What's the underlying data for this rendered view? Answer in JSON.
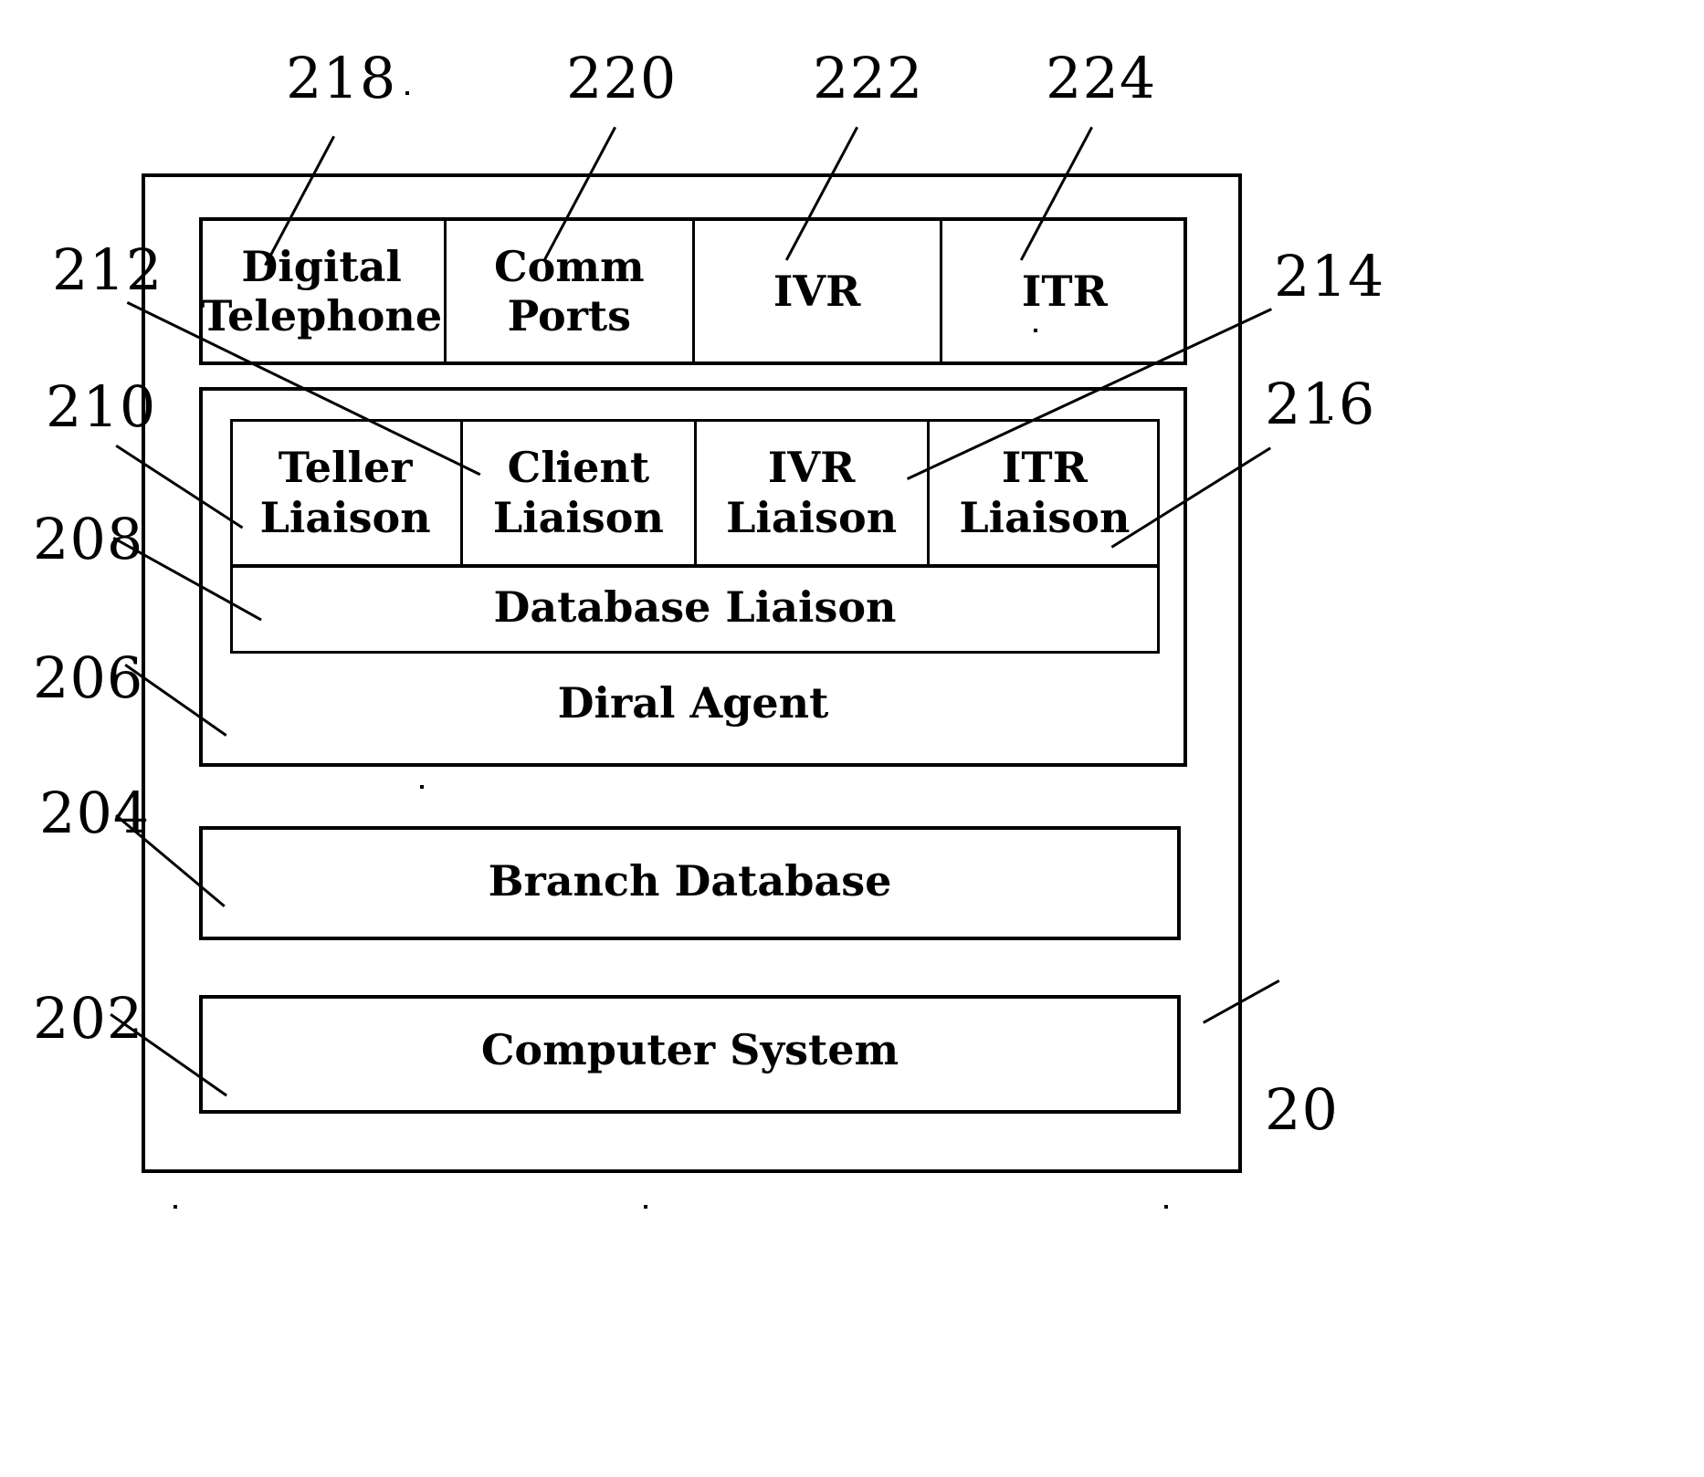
{
  "figure": {
    "outer_ref": "20",
    "top_row": {
      "refs": [
        "218",
        "220",
        "222",
        "224"
      ],
      "cells": [
        {
          "line1": "Digital",
          "line2": "Telephone"
        },
        {
          "line1": "Comm",
          "line2": "Ports"
        },
        {
          "line1": "IVR",
          "line2": ""
        },
        {
          "line1": "ITR",
          "line2": ""
        }
      ]
    },
    "agent_group": {
      "ref_left": "212",
      "ref_right": "214",
      "agent_label": "Diral Agent",
      "agent_ref": "206",
      "liaison_box": {
        "ref_left": "210",
        "ref_right": "216",
        "cells": [
          {
            "line1": "Teller",
            "line2": "Liaison"
          },
          {
            "line1": "Client",
            "line2": "Liaison"
          },
          {
            "line1": "IVR",
            "line2": "Liaison"
          },
          {
            "line1": "ITR",
            "line2": "Liaison"
          }
        ],
        "database_liaison_label": "Database Liaison",
        "database_liaison_ref": "208"
      }
    },
    "branch_database": {
      "label": "Branch Database",
      "ref": "204"
    },
    "computer_system": {
      "label": "Computer System",
      "ref": "202"
    }
  }
}
